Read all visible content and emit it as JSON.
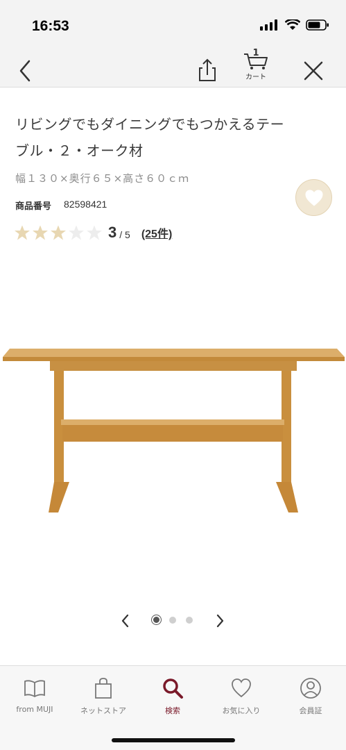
{
  "status_bar": {
    "time": "16:53"
  },
  "nav": {
    "cart_label": "カート",
    "cart_count": "1"
  },
  "product": {
    "title_line1": "リビングでもダイニングでもつかえるテー",
    "title_line2": "ブル・２・オーク材",
    "size": "幅１３０×奥行６５×高さ６０ｃｍ",
    "number_label": "商品番号",
    "number_value": "82598421",
    "rating": {
      "value": 3,
      "max": 5,
      "score_text": "3",
      "max_text": "/ 5",
      "count_text": "(25件)"
    }
  },
  "carousel": {
    "current": 1,
    "total": 3
  },
  "tabs": [
    {
      "label": "from MUJI",
      "icon": "book-icon"
    },
    {
      "label": "ネットストア",
      "icon": "bag-icon"
    },
    {
      "label": "検索",
      "icon": "search-icon"
    },
    {
      "label": "お気に入り",
      "icon": "heart-icon"
    },
    {
      "label": "会員証",
      "icon": "member-icon"
    }
  ],
  "colors": {
    "star_filled": "#e8d7b2",
    "star_empty": "#ededed",
    "accent": "#7a1a2a",
    "favorite_bg": "#f1e7d3",
    "wood": "#c9913f"
  }
}
